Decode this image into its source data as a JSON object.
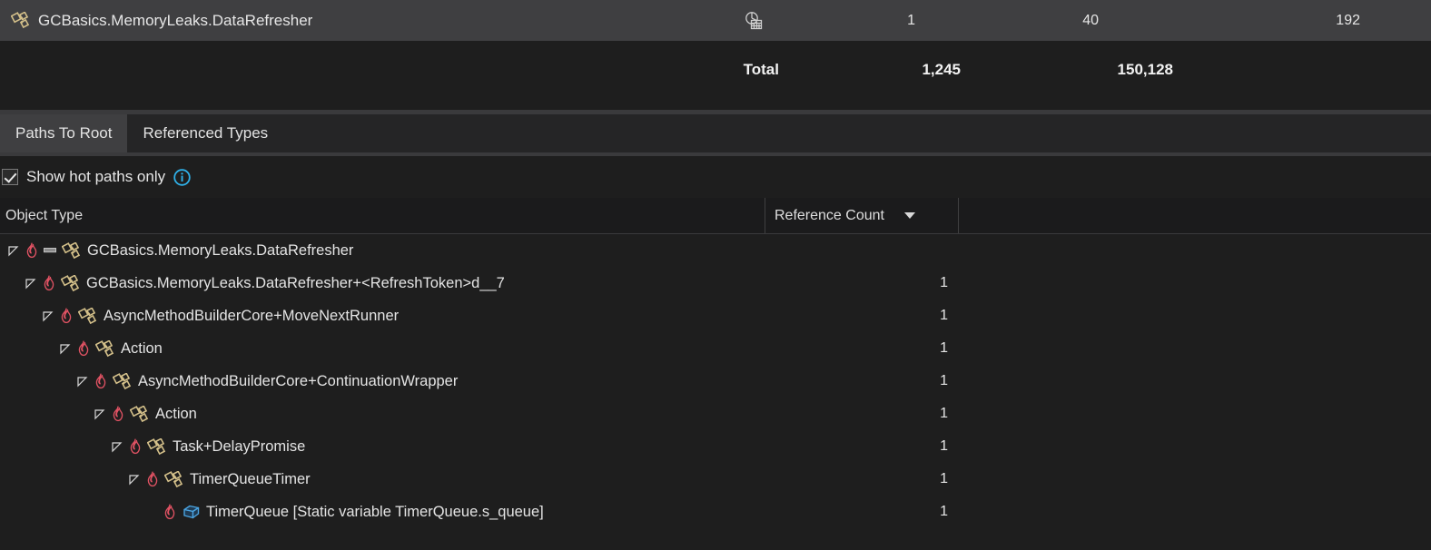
{
  "summary": {
    "type_icon": "class-icon",
    "type_name": "GCBasics.MemoryLeaks.DataRefresher",
    "chart_icon": "pie-bar-chart-icon",
    "count": "1",
    "size": "40",
    "inclusive_size": "192"
  },
  "totals": {
    "label": "Total",
    "count": "1,245",
    "size": "150,128"
  },
  "tabs": [
    {
      "label": "Paths To Root",
      "active": true
    },
    {
      "label": "Referenced Types",
      "active": false
    }
  ],
  "options": {
    "hot_paths_checkbox_label": "Show hot paths only",
    "hot_paths_checked": true,
    "info_icon": "info-circle-icon"
  },
  "grid": {
    "columns": [
      {
        "label": "Object Type"
      },
      {
        "label": "Reference Count",
        "sort": "descending"
      }
    ],
    "rows": [
      {
        "depth": 0,
        "expanded": true,
        "hot": true,
        "root_badge": true,
        "icon": "class-icon",
        "label": "GCBasics.MemoryLeaks.DataRefresher",
        "count": ""
      },
      {
        "depth": 1,
        "expanded": true,
        "hot": true,
        "root_badge": false,
        "icon": "class-icon",
        "label": "GCBasics.MemoryLeaks.DataRefresher+<RefreshToken>d__7",
        "count": "1"
      },
      {
        "depth": 2,
        "expanded": true,
        "hot": true,
        "root_badge": false,
        "icon": "class-icon",
        "label": "AsyncMethodBuilderCore+MoveNextRunner",
        "count": "1"
      },
      {
        "depth": 3,
        "expanded": true,
        "hot": true,
        "root_badge": false,
        "icon": "class-icon",
        "label": "Action",
        "count": "1"
      },
      {
        "depth": 4,
        "expanded": true,
        "hot": true,
        "root_badge": false,
        "icon": "class-icon",
        "label": "AsyncMethodBuilderCore+ContinuationWrapper",
        "count": "1"
      },
      {
        "depth": 5,
        "expanded": true,
        "hot": true,
        "root_badge": false,
        "icon": "class-icon",
        "label": "Action",
        "count": "1"
      },
      {
        "depth": 6,
        "expanded": true,
        "hot": true,
        "root_badge": false,
        "icon": "class-icon",
        "label": "Task+DelayPromise",
        "count": "1"
      },
      {
        "depth": 7,
        "expanded": true,
        "hot": true,
        "root_badge": false,
        "icon": "class-icon",
        "label": "TimerQueueTimer",
        "count": "1"
      },
      {
        "depth": 8,
        "expanded": false,
        "hot": true,
        "root_badge": false,
        "icon": "object-cube-icon",
        "label": "TimerQueue [Static variable TimerQueue.s_queue]",
        "count": "1"
      }
    ]
  },
  "colors": {
    "background": "#1e1e1e",
    "selected_row": "#3f3f41",
    "hot_flame": "#e05263",
    "class_icon": "#d4c08a",
    "cube_icon": "#4aa3e0",
    "info_icon": "#2fb0e8",
    "text": "#e4e4e4"
  }
}
